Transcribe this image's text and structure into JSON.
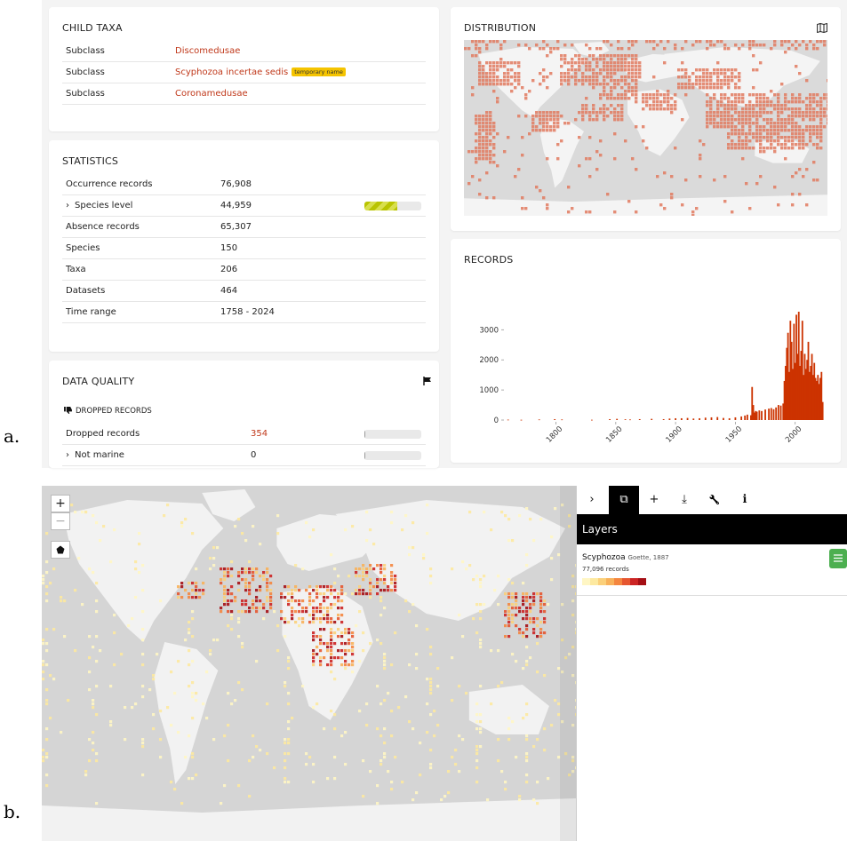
{
  "figure_labels": {
    "a": "a.",
    "b": "b."
  },
  "child_taxa": {
    "title": "CHILD TAXA",
    "rows": [
      {
        "rank": "Subclass",
        "name": "Discomedusae",
        "tag": ""
      },
      {
        "rank": "Subclass",
        "name": "Scyphozoa incertae sedis",
        "tag": "temporary name"
      },
      {
        "rank": "Subclass",
        "name": "Coronamedusae",
        "tag": ""
      }
    ]
  },
  "statistics": {
    "title": "STATISTICS",
    "rows": [
      {
        "label": "Occurrence records",
        "value": "76,908",
        "expand": false,
        "progress": null
      },
      {
        "label": "Species level",
        "value": "44,959",
        "expand": true,
        "progress": 0.58
      },
      {
        "label": "Absence records",
        "value": "65,307",
        "expand": false,
        "progress": null
      },
      {
        "label": "Species",
        "value": "150",
        "expand": false,
        "progress": null
      },
      {
        "label": "Taxa",
        "value": "206",
        "expand": false,
        "progress": null
      },
      {
        "label": "Datasets",
        "value": "464",
        "expand": false,
        "progress": null
      },
      {
        "label": "Time range",
        "value": "1758 - 2024",
        "expand": false,
        "progress": null
      }
    ]
  },
  "data_quality": {
    "title": "DATA QUALITY",
    "flag_icon": "flag-icon",
    "section": "DROPPED RECORDS",
    "section_icon": "thumbs-down-icon",
    "rows": [
      {
        "label": "Dropped records",
        "value": "354",
        "expand": false,
        "link": true,
        "progress": 0.01
      },
      {
        "label": "Not marine",
        "value": "0",
        "expand": true,
        "link": false,
        "progress": 0
      }
    ]
  },
  "distribution": {
    "title": "DISTRIBUTION",
    "icon": "map-icon",
    "cell_color": "#e07a5f",
    "land_color": "#f4f4f4",
    "sea_color": "#d9d9d9"
  },
  "records_chart": {
    "title": "RECORDS"
  },
  "chart_data": {
    "type": "bar",
    "title": "",
    "xlabel": "",
    "ylabel": "",
    "xlim": [
      1758,
      2024
    ],
    "ylim": [
      0,
      3600
    ],
    "xticks": [
      "1800",
      "1850",
      "1900",
      "1950",
      "2000"
    ],
    "yticks": [
      "0",
      "1000",
      "2000",
      "3000"
    ],
    "color": "#cc3300",
    "x": [
      1760,
      1771,
      1786,
      1799,
      1805,
      1830,
      1845,
      1851,
      1858,
      1862,
      1870,
      1880,
      1890,
      1895,
      1900,
      1905,
      1910,
      1915,
      1920,
      1925,
      1930,
      1935,
      1940,
      1945,
      1950,
      1955,
      1958,
      1960,
      1963,
      1964,
      1965,
      1966,
      1967,
      1968,
      1970,
      1972,
      1975,
      1978,
      1980,
      1982,
      1984,
      1986,
      1988,
      1990,
      1991,
      1992,
      1993,
      1994,
      1995,
      1996,
      1997,
      1998,
      1999,
      2000,
      2001,
      2002,
      2003,
      2004,
      2005,
      2006,
      2007,
      2008,
      2009,
      2010,
      2011,
      2012,
      2013,
      2014,
      2015,
      2016,
      2017,
      2018,
      2019,
      2020,
      2021,
      2022,
      2023
    ],
    "values": [
      15,
      10,
      20,
      30,
      20,
      10,
      30,
      40,
      25,
      20,
      30,
      40,
      30,
      50,
      60,
      60,
      70,
      50,
      60,
      80,
      90,
      100,
      70,
      60,
      90,
      120,
      150,
      180,
      160,
      1100,
      500,
      250,
      300,
      280,
      320,
      300,
      350,
      380,
      400,
      360,
      420,
      500,
      480,
      550,
      1300,
      1800,
      2400,
      2900,
      1600,
      3300,
      2600,
      1700,
      3200,
      1900,
      3500,
      2200,
      3600,
      1800,
      2300,
      3300,
      1500,
      2200,
      1700,
      2000,
      2600,
      1600,
      1800,
      2200,
      1500,
      1900,
      1400,
      1300,
      1500,
      1200,
      1400,
      1600,
      600
    ]
  },
  "map_b": {
    "zoom_in": "+",
    "zoom_out": "−",
    "polygon_icon": "pentagon-icon",
    "land_color": "#f2f2f2",
    "sea_color": "#d5d5d5"
  },
  "side_panel": {
    "tabs": [
      {
        "name": "collapse",
        "glyph": "›",
        "icon": "chevron-right-icon"
      },
      {
        "name": "layers",
        "glyph": "⧉",
        "icon": "layers-icon",
        "active": true
      },
      {
        "name": "add",
        "glyph": "+",
        "icon": "plus-icon"
      },
      {
        "name": "download",
        "glyph": "⤓",
        "icon": "download-icon"
      },
      {
        "name": "tools",
        "glyph": "🔧",
        "icon": "wrench-icon"
      },
      {
        "name": "info",
        "glyph": "ℹ",
        "icon": "info-icon"
      }
    ],
    "header": "Layers",
    "layer": {
      "name": "Scyphozoa",
      "authority": "Goette, 1887",
      "records": "77,096 records",
      "menu_icon": "hamburger-icon",
      "legend_colors": [
        "#fff6c4",
        "#fde9a0",
        "#fbd07a",
        "#f8b15a",
        "#f4863f",
        "#e65630",
        "#cc2424",
        "#a50f15"
      ]
    }
  }
}
